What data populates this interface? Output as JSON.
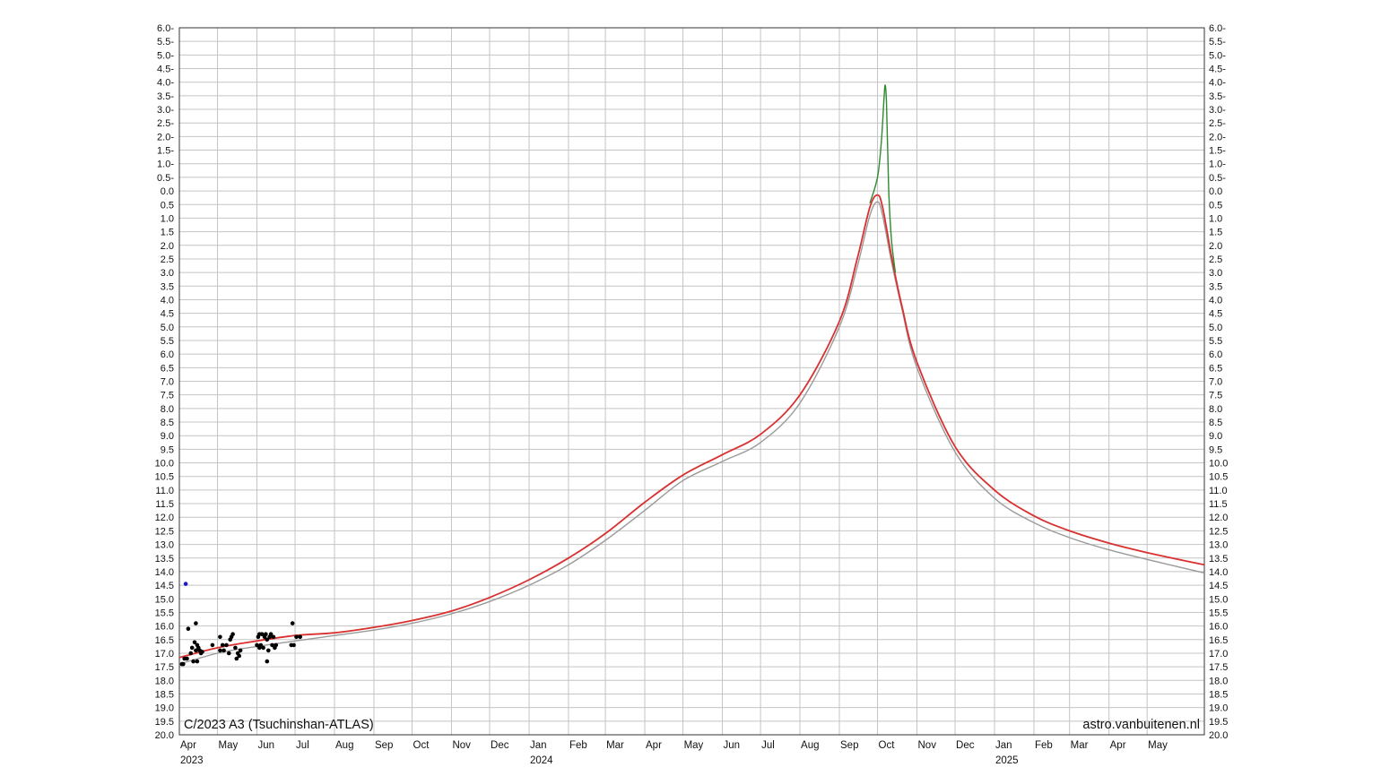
{
  "chart_data": {
    "type": "line",
    "title": "C/2023 A3 (Tsuchinshan-ATLAS)",
    "credit": "astro.vanbuitenen.nl",
    "xlabel": "",
    "ylabel": "",
    "x_axis": "date",
    "xlim": [
      "2023-04-01",
      "2025-06-15"
    ],
    "ylim": [
      20.0,
      -6.0
    ],
    "y_inverted": true,
    "y_tick_labels": [
      "6.0-",
      "5.5-",
      "5.0-",
      "4.5-",
      "4.0-",
      "3.5-",
      "3.0-",
      "2.5-",
      "2.0-",
      "1.5-",
      "1.0-",
      "0.5-",
      "0.0",
      "0.5",
      "1.0",
      "1.5",
      "2.0",
      "2.5",
      "3.0",
      "3.5",
      "4.0",
      "4.5",
      "5.0",
      "5.5",
      "6.0",
      "6.5",
      "7.0",
      "7.5",
      "8.0",
      "8.5",
      "9.0",
      "9.5",
      "10.0",
      "10.5",
      "11.0",
      "11.5",
      "12.0",
      "12.5",
      "13.0",
      "13.5",
      "14.0",
      "14.5",
      "15.0",
      "15.5",
      "16.0",
      "16.5",
      "17.0",
      "17.5",
      "18.0",
      "18.5",
      "19.0",
      "19.5",
      "20.0"
    ],
    "x_month_labels": [
      "Apr",
      "May",
      "Jun",
      "Jul",
      "Aug",
      "Sep",
      "Oct",
      "Nov",
      "Dec",
      "Jan",
      "Feb",
      "Mar",
      "Apr",
      "May",
      "Jun",
      "Jul",
      "Aug",
      "Sep",
      "Oct",
      "Nov",
      "Dec",
      "Jan",
      "Feb",
      "Mar",
      "Apr",
      "May"
    ],
    "x_month_dates": [
      "2023-04-01",
      "2023-05-01",
      "2023-06-01",
      "2023-07-01",
      "2023-08-01",
      "2023-09-01",
      "2023-10-01",
      "2023-11-01",
      "2023-12-01",
      "2024-01-01",
      "2024-02-01",
      "2024-03-01",
      "2024-04-01",
      "2024-05-01",
      "2024-06-01",
      "2024-07-01",
      "2024-08-01",
      "2024-09-01",
      "2024-10-01",
      "2024-11-01",
      "2024-12-01",
      "2025-01-01",
      "2025-02-01",
      "2025-03-01",
      "2025-04-01",
      "2025-05-01"
    ],
    "x_year_labels": [
      {
        "label": "2023",
        "date": "2023-04-01"
      },
      {
        "label": "2024",
        "date": "2024-01-01"
      },
      {
        "label": "2025",
        "date": "2025-01-01"
      }
    ],
    "grid": true,
    "series": [
      {
        "color": "#9a9a9a",
        "style": "line",
        "points": [
          [
            "2023-03-25",
            17.5
          ],
          [
            "2023-05-01",
            17.0
          ],
          [
            "2023-06-01",
            16.75
          ],
          [
            "2023-07-01",
            16.55
          ],
          [
            "2023-08-01",
            16.35
          ],
          [
            "2023-09-01",
            16.15
          ],
          [
            "2023-10-01",
            15.9
          ],
          [
            "2023-11-01",
            15.55
          ],
          [
            "2023-12-01",
            15.1
          ],
          [
            "2024-01-01",
            14.5
          ],
          [
            "2024-02-01",
            13.75
          ],
          [
            "2024-03-01",
            12.85
          ],
          [
            "2024-04-01",
            11.75
          ],
          [
            "2024-05-01",
            10.65
          ],
          [
            "2024-06-01",
            9.95
          ],
          [
            "2024-07-01",
            9.25
          ],
          [
            "2024-08-01",
            7.8
          ],
          [
            "2024-09-01",
            5.0
          ],
          [
            "2024-09-15",
            2.8
          ],
          [
            "2024-09-25",
            0.9
          ],
          [
            "2024-10-01",
            0.4
          ],
          [
            "2024-10-05",
            0.9
          ],
          [
            "2024-10-12",
            2.6
          ],
          [
            "2024-10-20",
            4.3
          ],
          [
            "2024-11-01",
            6.5
          ],
          [
            "2024-12-01",
            9.6
          ],
          [
            "2025-01-01",
            11.3
          ],
          [
            "2025-02-01",
            12.2
          ],
          [
            "2025-03-01",
            12.75
          ],
          [
            "2025-04-01",
            13.2
          ],
          [
            "2025-05-01",
            13.55
          ],
          [
            "2025-06-15",
            14.05
          ]
        ]
      },
      {
        "color": "#d93030",
        "style": "line",
        "points": [
          [
            "2023-03-25",
            17.25
          ],
          [
            "2023-05-01",
            16.8
          ],
          [
            "2023-06-01",
            16.55
          ],
          [
            "2023-07-01",
            16.35
          ],
          [
            "2023-08-01",
            16.25
          ],
          [
            "2023-09-01",
            16.05
          ],
          [
            "2023-10-01",
            15.8
          ],
          [
            "2023-11-01",
            15.45
          ],
          [
            "2023-12-01",
            14.95
          ],
          [
            "2024-01-01",
            14.3
          ],
          [
            "2024-02-01",
            13.5
          ],
          [
            "2024-03-01",
            12.6
          ],
          [
            "2024-04-01",
            11.45
          ],
          [
            "2024-05-01",
            10.45
          ],
          [
            "2024-06-01",
            9.7
          ],
          [
            "2024-07-01",
            8.95
          ],
          [
            "2024-08-01",
            7.5
          ],
          [
            "2024-09-01",
            4.8
          ],
          [
            "2024-09-15",
            2.5
          ],
          [
            "2024-09-25",
            0.6
          ],
          [
            "2024-10-01",
            0.15
          ],
          [
            "2024-10-05",
            0.6
          ],
          [
            "2024-10-12",
            2.4
          ],
          [
            "2024-10-20",
            4.2
          ],
          [
            "2024-11-01",
            6.3
          ],
          [
            "2024-12-01",
            9.4
          ],
          [
            "2025-01-01",
            11.0
          ],
          [
            "2025-02-01",
            11.95
          ],
          [
            "2025-03-01",
            12.5
          ],
          [
            "2025-04-01",
            12.95
          ],
          [
            "2025-05-01",
            13.3
          ],
          [
            "2025-06-15",
            13.75
          ]
        ]
      },
      {
        "color": "#2e8b2e",
        "style": "line",
        "points": [
          [
            "2024-09-25",
            0.45
          ],
          [
            "2024-10-01",
            -0.5
          ],
          [
            "2024-10-04",
            -1.8
          ],
          [
            "2024-10-06",
            -3.3
          ],
          [
            "2024-10-07",
            -3.9
          ],
          [
            "2024-10-08",
            -3.3
          ],
          [
            "2024-10-09",
            -1.5
          ],
          [
            "2024-10-10",
            0.2
          ],
          [
            "2024-10-12",
            1.8
          ],
          [
            "2024-10-15",
            3.0
          ]
        ]
      }
    ],
    "observations": [
      {
        "color": "#000000",
        "points": [
          [
            "2023-04-03",
            17.4
          ],
          [
            "2023-04-04",
            17.4
          ],
          [
            "2023-04-05",
            17.2
          ],
          [
            "2023-04-07",
            17.2
          ],
          [
            "2023-04-08",
            16.1
          ],
          [
            "2023-04-10",
            17.0
          ],
          [
            "2023-04-11",
            16.8
          ],
          [
            "2023-04-12",
            17.3
          ],
          [
            "2023-04-13",
            16.6
          ],
          [
            "2023-04-14",
            16.9
          ],
          [
            "2023-04-14",
            15.9
          ],
          [
            "2023-04-15",
            17.3
          ],
          [
            "2023-04-15",
            16.7
          ],
          [
            "2023-04-16",
            16.8
          ],
          [
            "2023-04-17",
            16.9
          ],
          [
            "2023-04-18",
            17.0
          ],
          [
            "2023-04-19",
            16.95
          ],
          [
            "2023-04-27",
            16.7
          ],
          [
            "2023-05-03",
            16.4
          ],
          [
            "2023-05-03",
            16.9
          ],
          [
            "2023-05-05",
            16.7
          ],
          [
            "2023-05-06",
            16.9
          ],
          [
            "2023-05-08",
            16.7
          ],
          [
            "2023-05-10",
            17.0
          ],
          [
            "2023-05-11",
            16.5
          ],
          [
            "2023-05-12",
            16.4
          ],
          [
            "2023-05-13",
            16.3
          ],
          [
            "2023-05-15",
            16.8
          ],
          [
            "2023-05-16",
            17.2
          ],
          [
            "2023-05-17",
            17.0
          ],
          [
            "2023-05-18",
            17.1
          ],
          [
            "2023-05-19",
            16.9
          ],
          [
            "2023-06-01",
            16.7
          ],
          [
            "2023-06-02",
            16.4
          ],
          [
            "2023-06-03",
            16.3
          ],
          [
            "2023-06-03",
            16.8
          ],
          [
            "2023-06-04",
            16.7
          ],
          [
            "2023-06-05",
            16.3
          ],
          [
            "2023-06-06",
            16.8
          ],
          [
            "2023-06-07",
            16.4
          ],
          [
            "2023-06-08",
            16.3
          ],
          [
            "2023-06-09",
            17.3
          ],
          [
            "2023-06-09",
            16.5
          ],
          [
            "2023-06-10",
            16.9
          ],
          [
            "2023-06-11",
            16.4
          ],
          [
            "2023-06-12",
            16.3
          ],
          [
            "2023-06-13",
            16.7
          ],
          [
            "2023-06-14",
            16.4
          ],
          [
            "2023-06-15",
            16.8
          ],
          [
            "2023-06-16",
            16.7
          ],
          [
            "2023-06-28",
            16.7
          ],
          [
            "2023-06-29",
            15.9
          ],
          [
            "2023-06-30",
            16.7
          ],
          [
            "2023-07-02",
            16.4
          ],
          [
            "2023-07-05",
            16.4
          ]
        ]
      },
      {
        "color": "#1a1acc",
        "points": [
          [
            "2023-04-06",
            14.45
          ]
        ]
      }
    ]
  }
}
